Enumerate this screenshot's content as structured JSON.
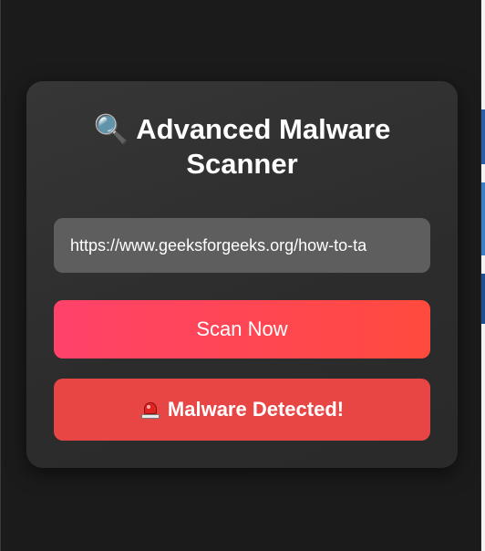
{
  "app": {
    "title_icon": "magnifying-glass-icon",
    "title_emoji": "🔍",
    "title": "Advanced Malware Scanner"
  },
  "scanner": {
    "url_value": "https://www.geeksforgeeks.org/how-to-ta",
    "scan_button_label": "Scan Now",
    "result_icon": "siren-icon",
    "result_text": "Malware Detected!"
  },
  "colors": {
    "background": "#1b1b1b",
    "card": "#2f2f2f",
    "input": "#5e5e5e",
    "scan_gradient_start": "#ff426a",
    "scan_gradient_end": "#ff4a3e",
    "alert": "#e84545",
    "text": "#ffffff"
  }
}
